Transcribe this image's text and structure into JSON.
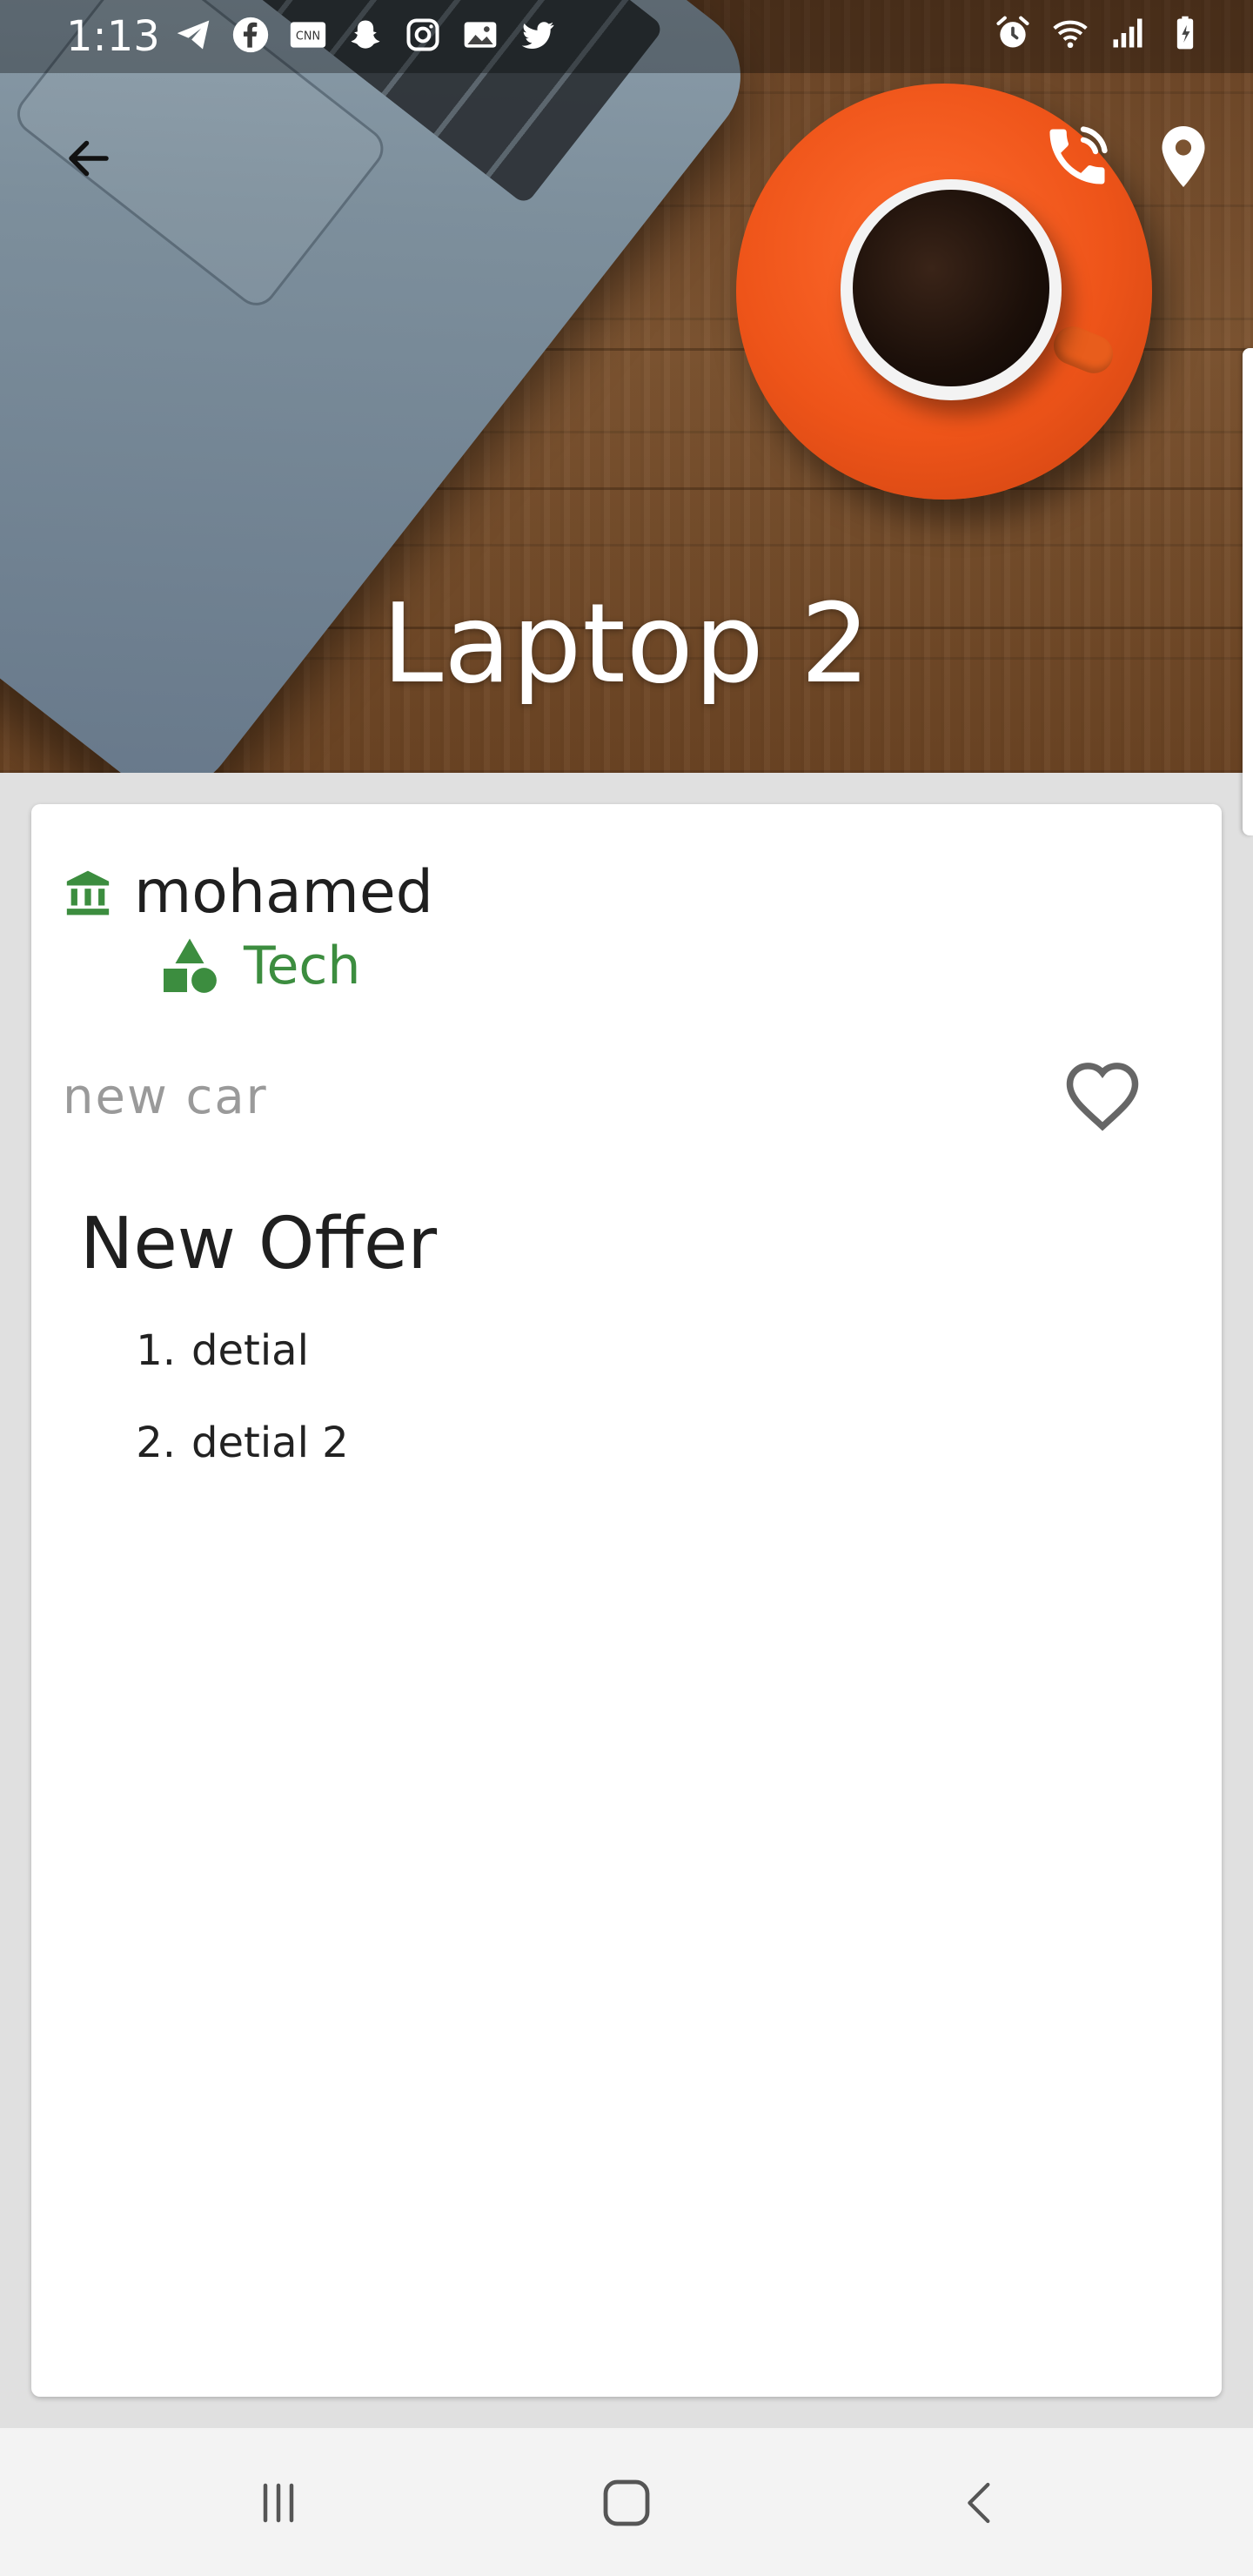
{
  "status_bar": {
    "time": "1:13",
    "left_icons": [
      "telegram-icon",
      "facebook-icon",
      "cnn-icon",
      "snapchat-icon",
      "instagram-icon",
      "gallery-icon",
      "twitter-icon"
    ],
    "right_icons": [
      "alarm-icon",
      "wifi-icon",
      "signal-icon",
      "battery-icon"
    ]
  },
  "header": {
    "title": "Laptop 2",
    "back_icon": "arrow-back-icon",
    "call_icon": "phone-call-icon",
    "location_icon": "location-pin-icon"
  },
  "detail": {
    "company_name": "mohamed",
    "category": "Tech",
    "subtitle": "new car",
    "offer_title": "New Offer",
    "details": [
      {
        "number": "1.",
        "text": "detial"
      },
      {
        "number": "2.",
        "text": "detial 2"
      }
    ],
    "favorited": false
  },
  "colors": {
    "accent_green": "#3c8d3f",
    "text_dark": "#1f1f1f",
    "text_muted": "#9a9a9a",
    "saucer_orange": "#ee5419"
  },
  "nav_bar": {
    "recent_icon": "recent-apps-icon",
    "home_icon": "home-icon",
    "back_icon": "nav-back-icon"
  }
}
